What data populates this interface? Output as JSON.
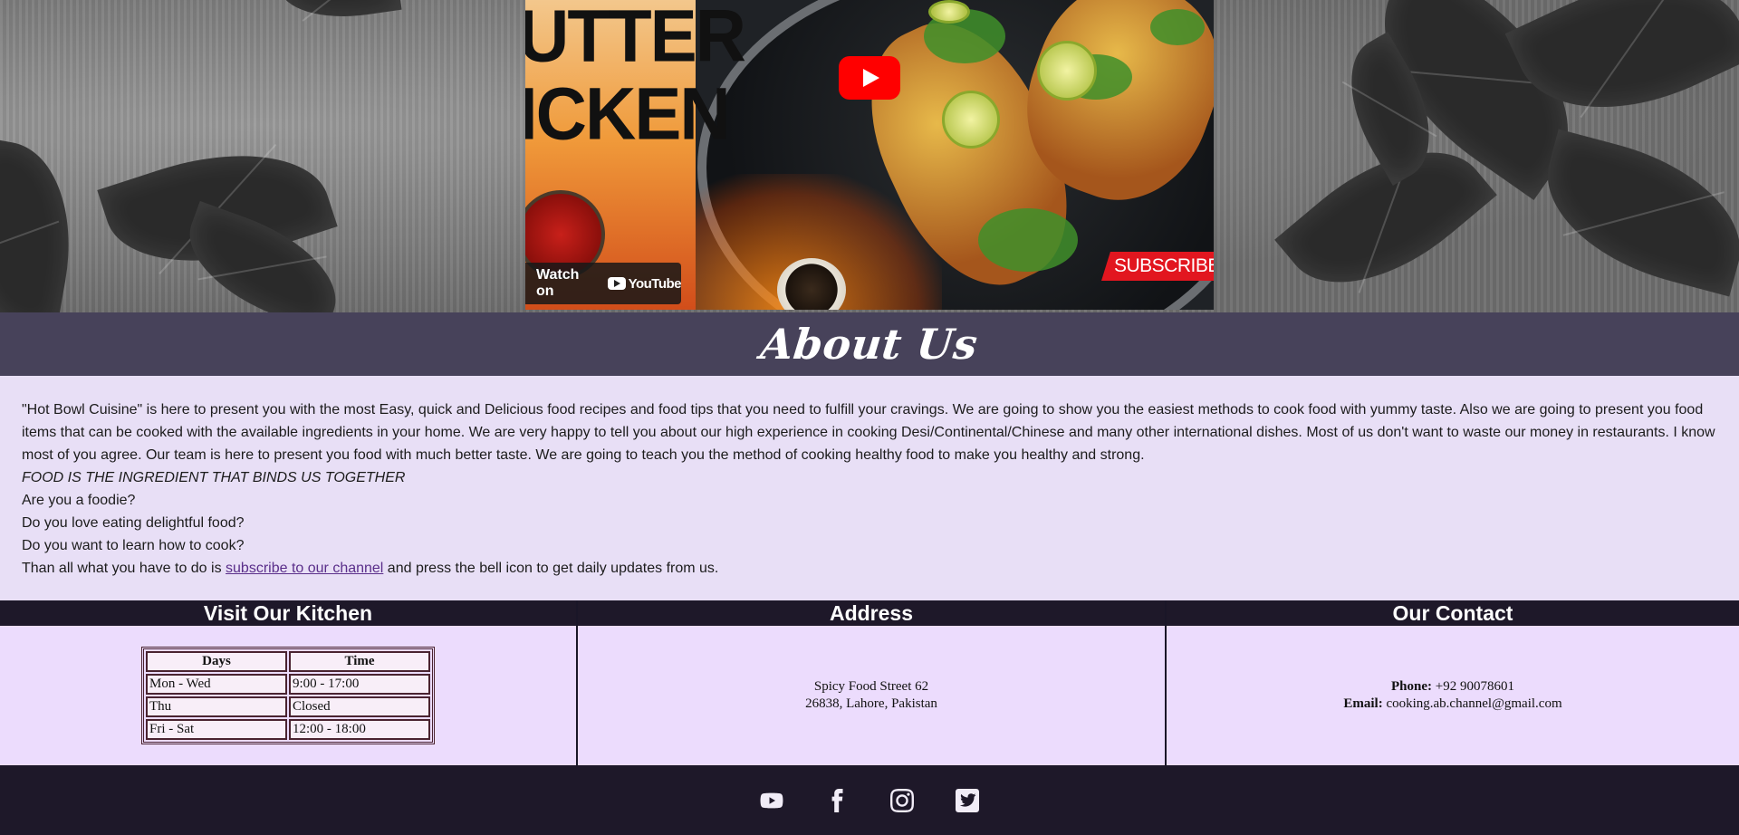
{
  "video": {
    "thumbnail_title": "UTTER\nICKEN",
    "watch_on_label": "Watch on",
    "youtube_logo_text": "YouTube",
    "subscribe_banner": "SUBSCRIBE",
    "play_icon": "youtube-play-icon"
  },
  "about": {
    "title": "About Us",
    "paragraph": "\"Hot Bowl Cuisine\" is here to present you with the most Easy, quick and Delicious food recipes and food tips that you need to fulfill your cravings. We are going to show you the easiest methods to cook food with yummy taste. Also we are going to present you food items that can be cooked with the available ingredients in your home. We are very happy to tell you about our high experience in cooking Desi/Continental/Chinese and many other international dishes. Most of us don't want to waste our money in restaurants. I know most of you agree. Our team is here to present you food with much better taste. We are going to teach you the method of cooking healthy food to make you healthy and strong.",
    "tagline": "FOOD IS THE INGREDIENT THAT BINDS US TOGETHER",
    "q1": "Are you a foodie?",
    "q2": "Do you love eating delightful food?",
    "q3": "Do you want to learn how to cook?",
    "cta_before": "Than all what you have to do is ",
    "cta_link": "subscribe to our channel",
    "cta_after": " and press the bell icon to get daily updates from us."
  },
  "kitchen": {
    "heading": "Visit Our Kitchen",
    "columns": [
      "Days",
      "Time"
    ],
    "rows": [
      [
        "Mon - Wed",
        "9:00 - 17:00"
      ],
      [
        "Thu",
        "Closed"
      ],
      [
        "Fri - Sat",
        "12:00 - 18:00"
      ]
    ]
  },
  "address": {
    "heading": "Address",
    "line1": "Spicy Food Street 62",
    "line2": "26838, Lahore, Pakistan"
  },
  "contact": {
    "heading": "Our Contact",
    "phone_label": "Phone:",
    "phone_value": " +92 90078601",
    "email_label": "Email:",
    "email_value": " cooking.ab.channel@gmail.com"
  },
  "footer": {
    "icons": [
      "youtube-icon",
      "facebook-icon",
      "instagram-icon",
      "twitter-icon"
    ]
  },
  "colors": {
    "about_band": "#47425a",
    "page_bg": "#e8dff6",
    "info_bg": "#ecdcfd",
    "dark": "#1e1829",
    "youtube_red": "#ff0000"
  }
}
